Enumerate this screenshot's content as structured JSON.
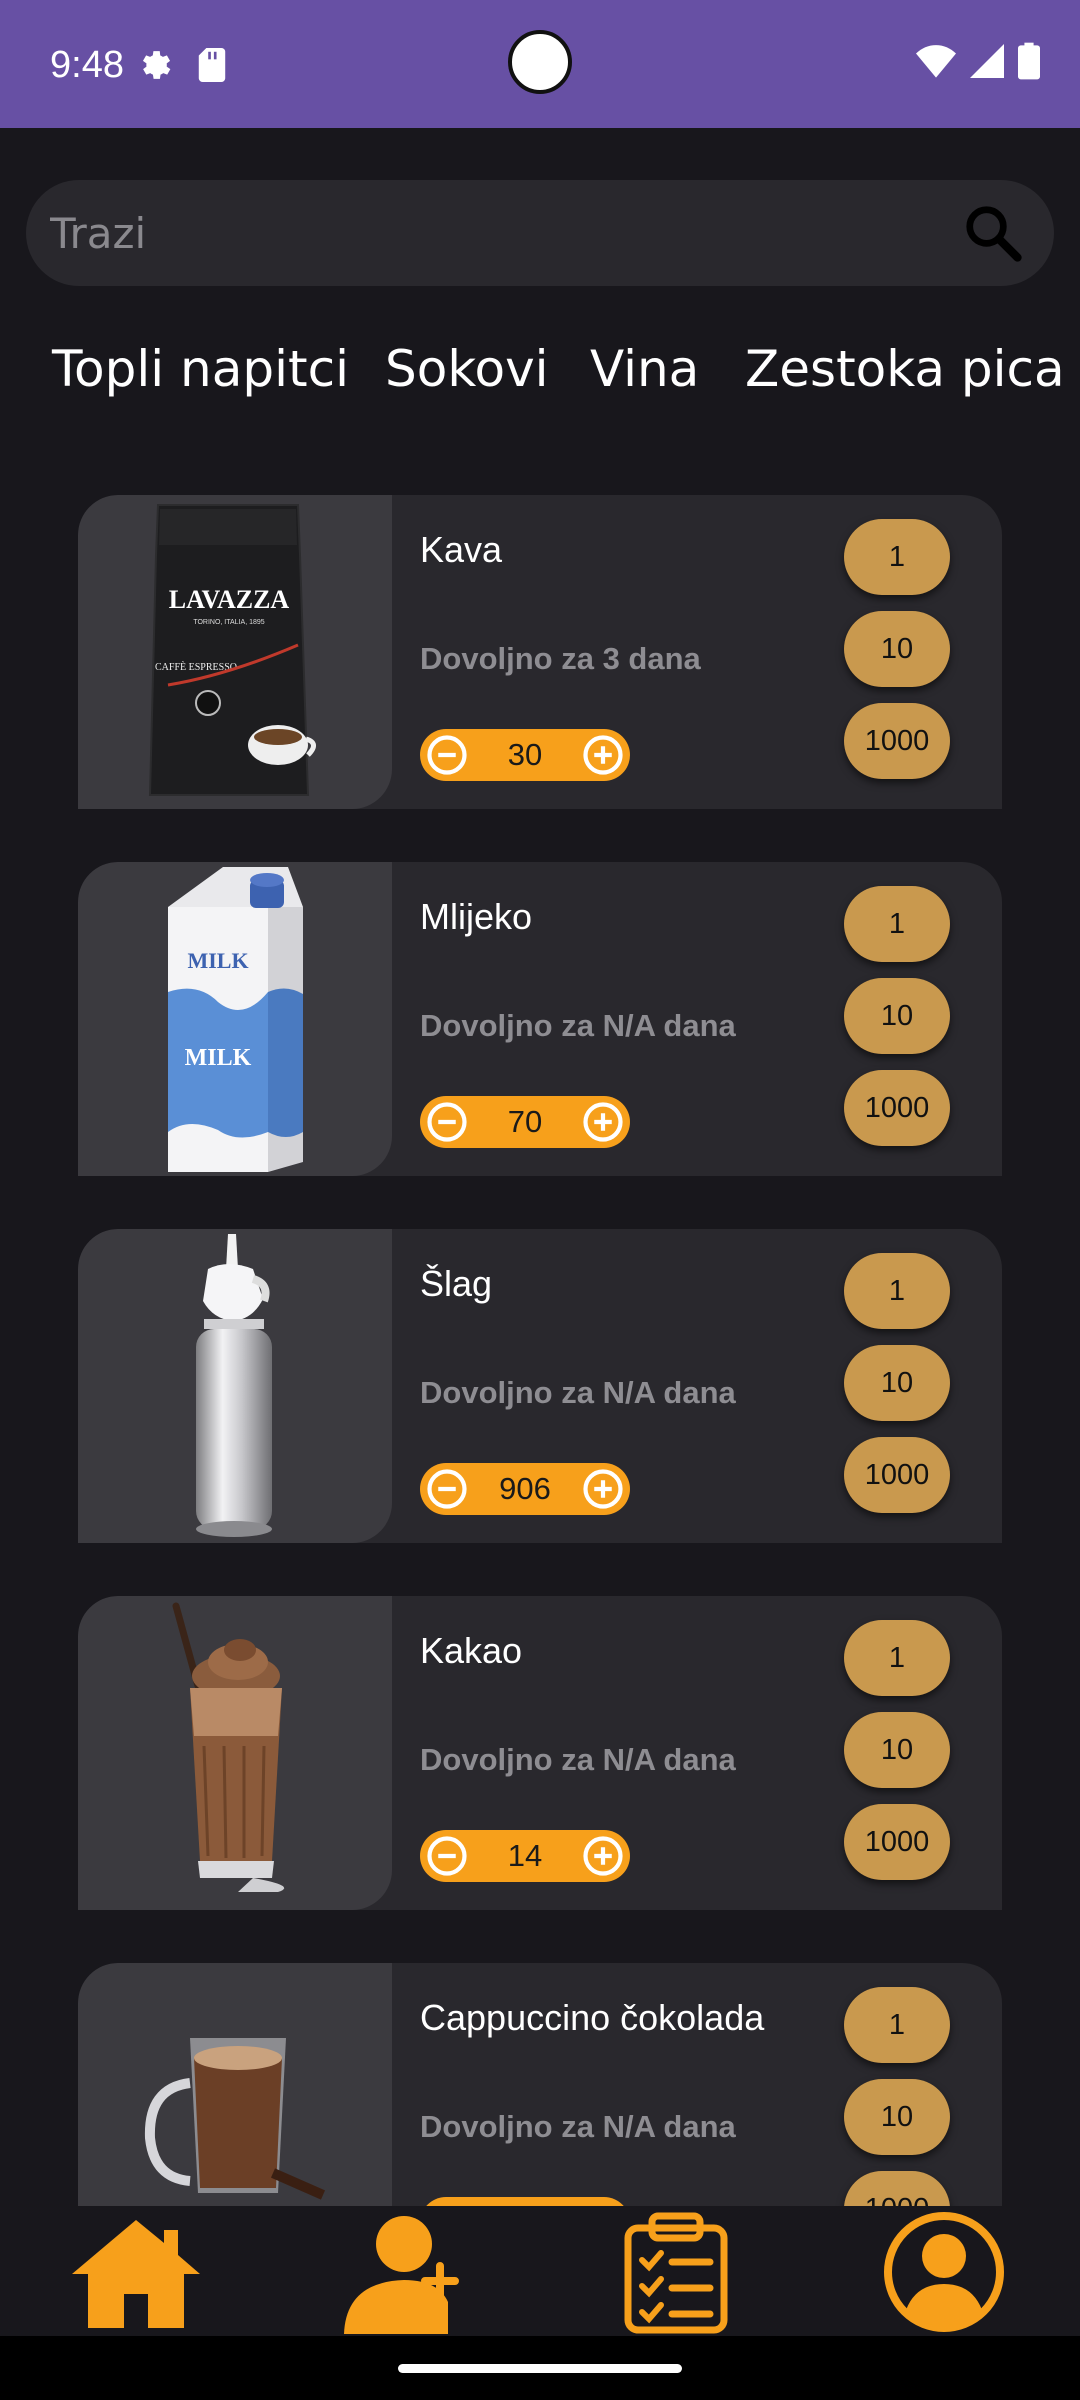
{
  "status_bar": {
    "time": "9:48",
    "icons": [
      "gear-icon",
      "sd-card-icon",
      "wifi-icon",
      "signal-icon",
      "battery-icon"
    ],
    "color": "#6750a4"
  },
  "search": {
    "placeholder": "Trazi",
    "icon": "search-icon"
  },
  "categories": [
    "Topli napitci",
    "Sokovi",
    "Vina",
    "Zestoka pica"
  ],
  "products": [
    {
      "name": "Kava",
      "availability": "Dovoljno za 3 dana",
      "quantity": "30",
      "increments": [
        "1",
        "10",
        "1000"
      ],
      "image": "coffee-bag"
    },
    {
      "name": "Mlijeko",
      "availability": "Dovoljno za N/A dana",
      "quantity": "70",
      "increments": [
        "1",
        "10",
        "1000"
      ],
      "image": "milk-carton",
      "image_text": "MILK"
    },
    {
      "name": "Šlag",
      "availability": "Dovoljno za N/A dana",
      "quantity": "906",
      "increments": [
        "1",
        "10",
        "1000"
      ],
      "image": "whipped-cream-dispenser"
    },
    {
      "name": "Kakao",
      "availability": "Dovoljno za N/A dana",
      "quantity": "14",
      "increments": [
        "1",
        "10",
        "1000"
      ],
      "image": "cocoa-glass"
    },
    {
      "name": "Cappuccino čokolada",
      "availability": "Dovoljno za N/A dana",
      "quantity": "",
      "increments": [
        "1",
        "10",
        "1000"
      ],
      "image": "cappuccino-mug"
    }
  ],
  "coffee_brand": {
    "logo": "LAVAZZA",
    "tagline": "TORINO, ITALIA, 1895",
    "product_line": "CAFFÈ ESPRESSO"
  },
  "bottom_nav": [
    "home-icon",
    "add-user-icon",
    "clipboard-checklist-icon",
    "account-icon"
  ],
  "colors": {
    "accent": "#f7a01b",
    "increment_button": "#c9994e",
    "card": "#29282d",
    "background": "#18171c"
  }
}
